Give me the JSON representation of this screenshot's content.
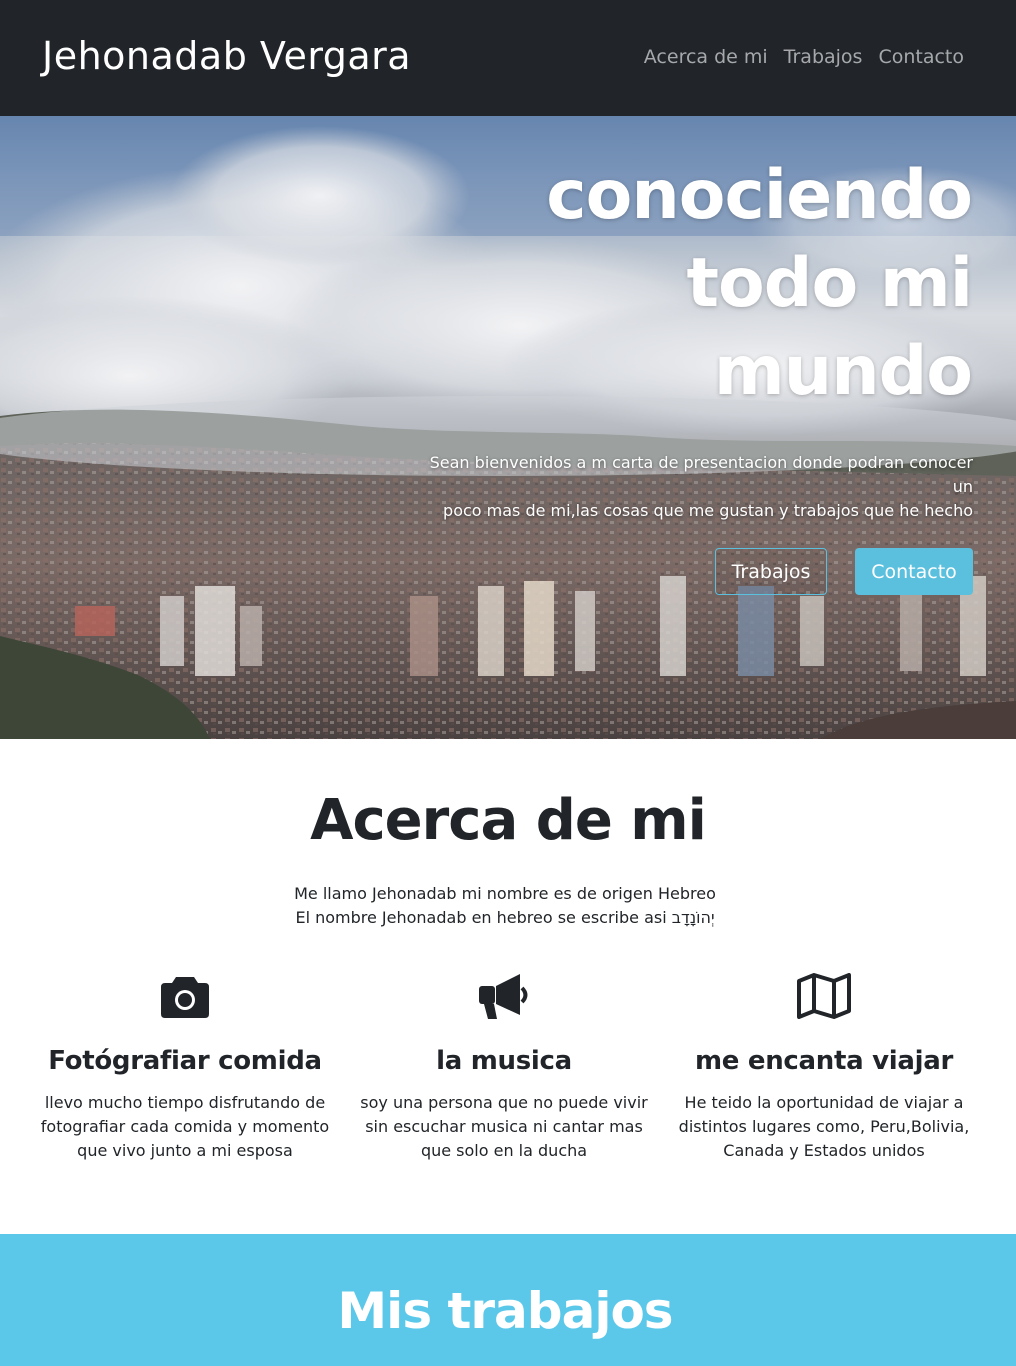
{
  "navbar": {
    "brand": "Jehonadab Vergara",
    "links": [
      "Acerca de mi",
      "Trabajos",
      "Contacto"
    ]
  },
  "hero": {
    "title_lines": [
      "conociendo",
      "todo mi",
      "mundo"
    ],
    "subtitle_lines": [
      "Sean bienvenidos a m carta de presentacion donde podran conocer un",
      "poco mas de mi,las cosas que me gustan y trabajos que he hecho"
    ],
    "btn_works": "Trabajos",
    "btn_contact": "Contacto"
  },
  "about": {
    "title": "Acerca de mi",
    "text_lines": [
      "Me llamo Jehonadab mi nombre es de origen Hebreo",
      "El nombre Jehonadab en hebreo se escribe asi יְהוֹנָדָב"
    ],
    "features": [
      {
        "icon": "camera-icon",
        "title": "Fotógrafiar comida",
        "text": "llevo mucho tiempo disfrutando de fotografiar cada comida y momento que vivo junto a mi esposa"
      },
      {
        "icon": "megaphone-icon",
        "title": "la musica",
        "text": "soy una persona que no puede vivir sin escuchar musica ni cantar mas que solo en la ducha"
      },
      {
        "icon": "map-icon",
        "title": "me encanta viajar",
        "text": "He teido la oportunidad de viajar a distintos lugares como, Peru,Bolivia, Canada y Estados unidos"
      }
    ]
  },
  "works": {
    "title": "Mis trabajos"
  },
  "colors": {
    "navbar_bg": "#212529",
    "accent": "#5bc0de",
    "works_bg": "#5bc8ea",
    "text": "#212529"
  }
}
